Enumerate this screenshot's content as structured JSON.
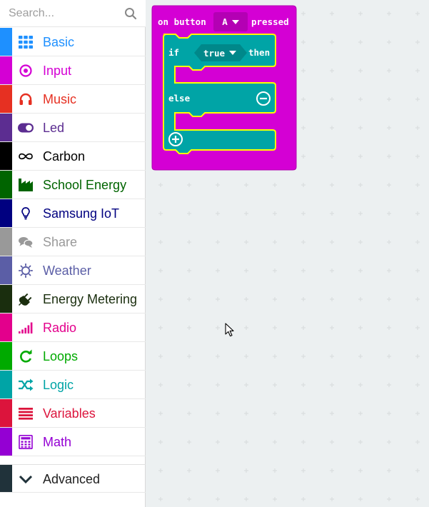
{
  "search": {
    "placeholder": "Search..."
  },
  "toolbox": {
    "categories": [
      {
        "label": "Basic",
        "color": "#1e90ff",
        "icon": "grid-icon"
      },
      {
        "label": "Input",
        "color": "#d400d4",
        "icon": "target-icon"
      },
      {
        "label": "Music",
        "color": "#e63022",
        "icon": "headphones-icon"
      },
      {
        "label": "Led",
        "color": "#5c2d91",
        "icon": "toggle-icon"
      },
      {
        "label": "Carbon",
        "color": "#000000",
        "icon": "infinity-icon"
      },
      {
        "label": "School Energy",
        "color": "#006400",
        "icon": "factory-icon"
      },
      {
        "label": "Samsung IoT",
        "color": "#000080",
        "icon": "lightbulb-icon"
      },
      {
        "label": "Share",
        "color": "#999999",
        "icon": "chat-icon"
      },
      {
        "label": "Weather",
        "color": "#5b5ea6",
        "icon": "sun-icon"
      },
      {
        "label": "Energy Metering",
        "color": "#1a2e0e",
        "icon": "plug-icon"
      },
      {
        "label": "Radio",
        "color": "#e3008c",
        "icon": "signal-icon"
      },
      {
        "label": "Loops",
        "color": "#00aa00",
        "icon": "refresh-icon"
      },
      {
        "label": "Logic",
        "color": "#00a4a6",
        "icon": "shuffle-icon"
      },
      {
        "label": "Variables",
        "color": "#dc143c",
        "icon": "list-icon"
      },
      {
        "label": "Math",
        "color": "#9400d3",
        "icon": "calculator-icon"
      }
    ],
    "advanced": {
      "label": "Advanced",
      "color": "#20323a",
      "icon": "chevron-down-icon"
    }
  },
  "blocks": {
    "event": {
      "prefix": "on button",
      "button_value": "A",
      "suffix": "pressed",
      "color": "#d400d4"
    },
    "if_else": {
      "if_label": "if",
      "condition_value": "true",
      "then_label": "then",
      "else_label": "else",
      "color": "#00a4a6",
      "highlight": "#ffff00"
    }
  }
}
